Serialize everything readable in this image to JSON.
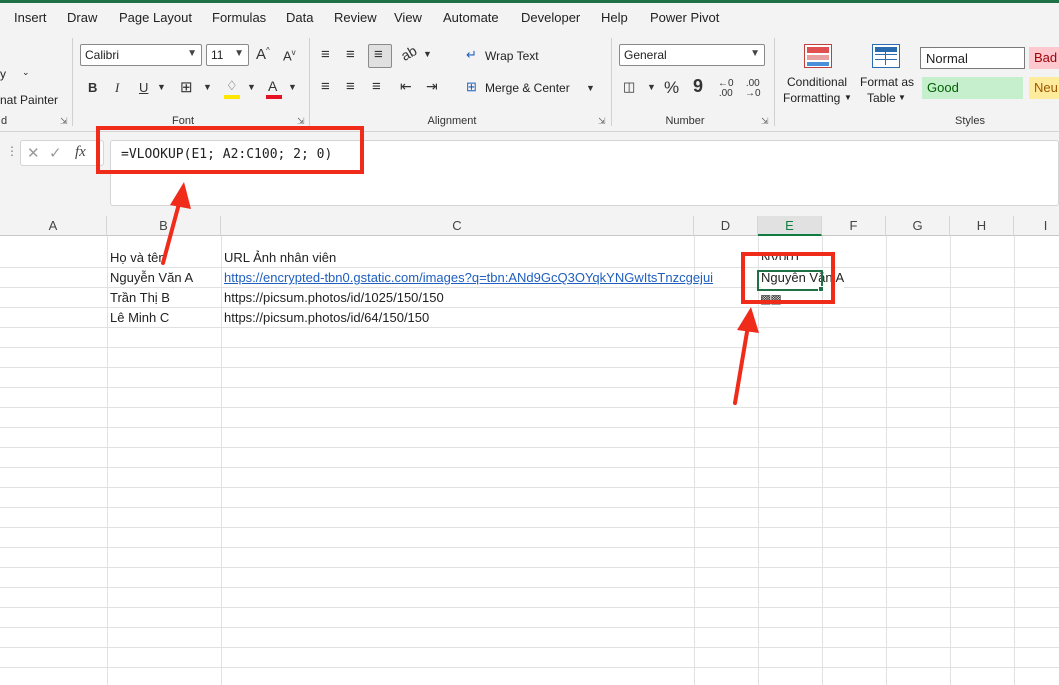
{
  "menu": {
    "tabs": [
      "Insert",
      "Draw",
      "Page Layout",
      "Formulas",
      "Data",
      "Review",
      "View",
      "Automate",
      "Developer",
      "Help",
      "Power Pivot"
    ]
  },
  "ribbon": {
    "clipboard": {
      "format_painter": "nat Painter",
      "group_label_fragment": "d"
    },
    "font": {
      "name": "Calibri",
      "size": "11",
      "group_label": "Font",
      "bold": "B",
      "italic": "I",
      "underline": "U"
    },
    "alignment": {
      "wrap_text": "Wrap Text",
      "merge_center": "Merge & Center",
      "group_label": "Alignment"
    },
    "number": {
      "format": "General",
      "percent": "%",
      "comma": "9",
      "group_label": "Number"
    },
    "styles": {
      "conditional_1": "Conditional",
      "conditional_2": "Formatting",
      "format_table_1": "Format as",
      "format_table_2": "Table",
      "normal": "Normal",
      "bad": "Bad",
      "good": "Good",
      "neutral": "Neu",
      "group_label": "Styles"
    }
  },
  "formula_bar": {
    "fx": "fx",
    "formula": "=VLOOKUP(E1; A2:C100; 2; 0)"
  },
  "columns": [
    "A",
    "B",
    "C",
    "D",
    "E",
    "F",
    "G",
    "H",
    "I"
  ],
  "cells": {
    "b1": "Họ và tên",
    "c1": "URL Ảnh nhân viên",
    "e1": "NV001",
    "b2": "Nguyễn Văn A",
    "c2": "https://encrypted-tbn0.gstatic.com/images?q=tbn:ANd9GcQ3OYqkYNGwItsTnzcgejui",
    "e2": "Nguyễn Văn A",
    "b3": "Trần Thị B",
    "c3": "https://picsum.photos/id/1025/150/150",
    "b4": "Lê Minh C",
    "c4": "https://picsum.photos/id/64/150/150"
  },
  "colors": {
    "excel_green": "#1e7145",
    "annotation_red": "#f02b1a",
    "link_blue": "#1f5fbf"
  }
}
